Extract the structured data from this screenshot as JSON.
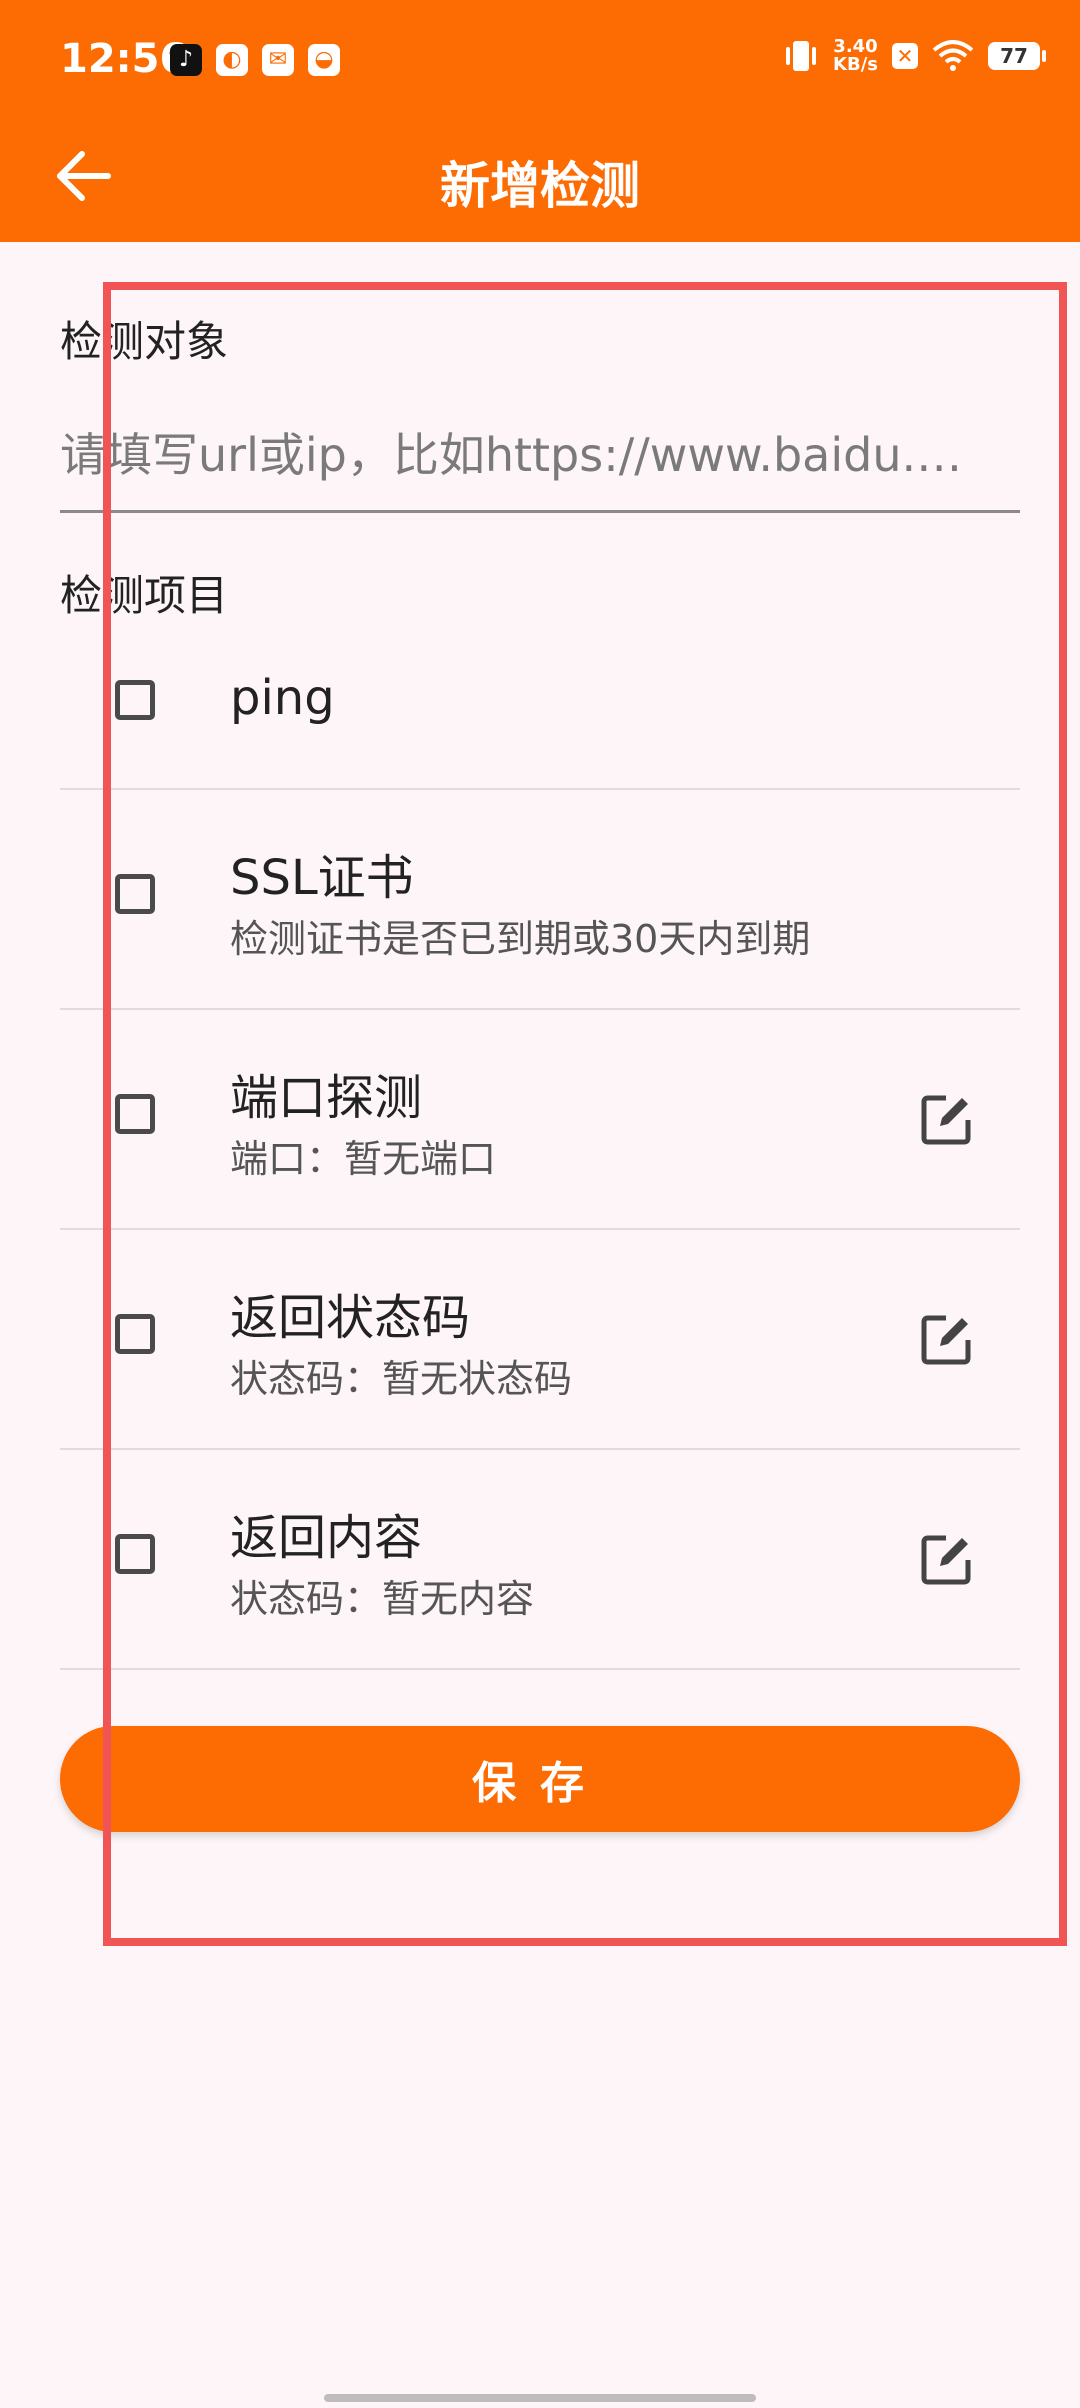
{
  "status_bar": {
    "time": "12:56",
    "net_speed_value": "3.40",
    "net_speed_unit": "KB/s",
    "battery": "77"
  },
  "header": {
    "title": "新增检测",
    "background_color": "#fd6b03"
  },
  "target": {
    "label": "检测对象",
    "placeholder": "请填写url或ip，比如https://www.baidu.…"
  },
  "items_section": {
    "label": "检测项目",
    "items": [
      {
        "title": "ping",
        "subtitle": "",
        "checked": false,
        "editable": false
      },
      {
        "title": "SSL证书",
        "subtitle": "检测证书是否已到期或30天内到期",
        "checked": false,
        "editable": false
      },
      {
        "title": "端口探测",
        "subtitle": "端口：暂无端口",
        "checked": false,
        "editable": true
      },
      {
        "title": "返回状态码",
        "subtitle": "状态码：暂无状态码",
        "checked": false,
        "editable": true
      },
      {
        "title": "返回内容",
        "subtitle": "状态码：暂无内容",
        "checked": false,
        "editable": true
      }
    ]
  },
  "save_button": {
    "label": "保存"
  }
}
